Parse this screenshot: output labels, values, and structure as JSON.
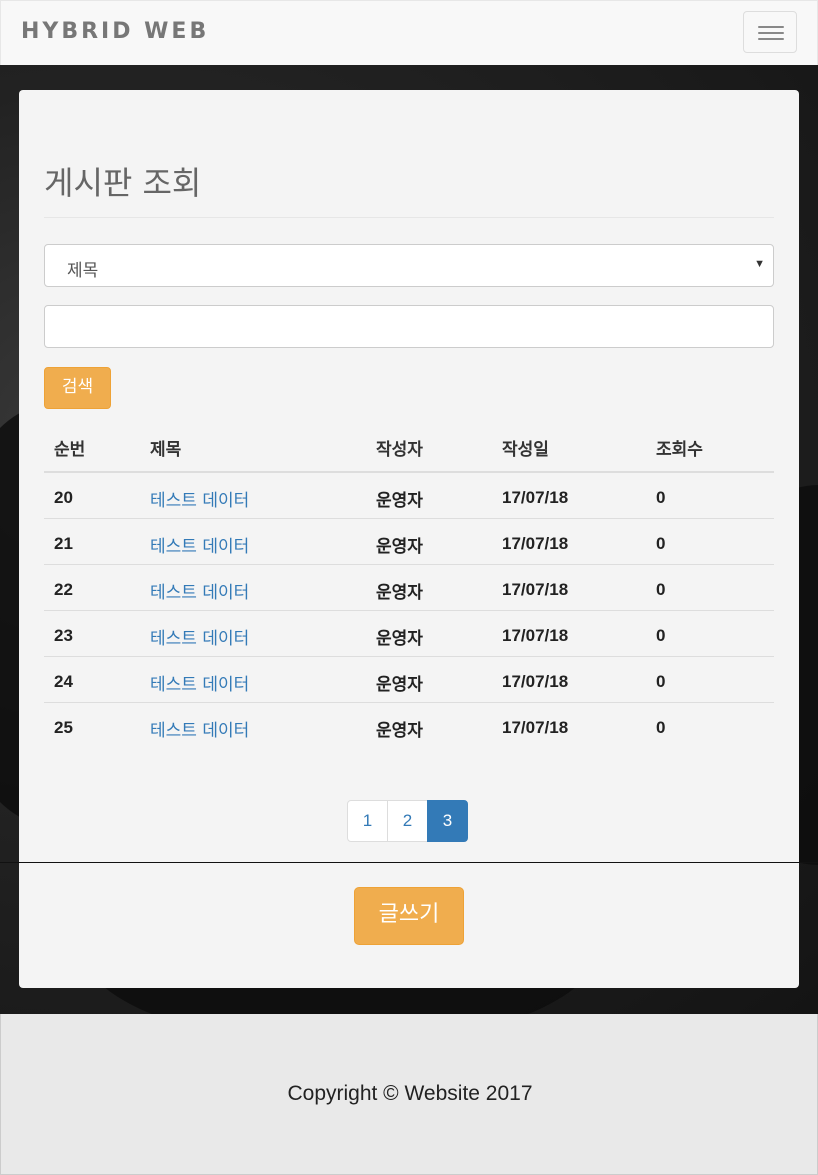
{
  "navbar": {
    "brand": "HYBRID WEB",
    "menu_icon": "hamburger-icon"
  },
  "page": {
    "title": "게시판 조회"
  },
  "search": {
    "field_selected": "제목",
    "keyword_value": "",
    "keyword_placeholder": "",
    "button_label": "검색"
  },
  "table": {
    "headers": [
      "순번",
      "제목",
      "작성자",
      "작성일",
      "조회수"
    ],
    "rows": [
      {
        "no": "20",
        "title": "테스트 데이터",
        "writer": "운영자",
        "date": "17/07/18",
        "views": "0"
      },
      {
        "no": "21",
        "title": "테스트 데이터",
        "writer": "운영자",
        "date": "17/07/18",
        "views": "0"
      },
      {
        "no": "22",
        "title": "테스트 데이터",
        "writer": "운영자",
        "date": "17/07/18",
        "views": "0"
      },
      {
        "no": "23",
        "title": "테스트 데이터",
        "writer": "운영자",
        "date": "17/07/18",
        "views": "0"
      },
      {
        "no": "24",
        "title": "테스트 데이터",
        "writer": "운영자",
        "date": "17/07/18",
        "views": "0"
      },
      {
        "no": "25",
        "title": "테스트 데이터",
        "writer": "운영자",
        "date": "17/07/18",
        "views": "0"
      }
    ]
  },
  "pagination": {
    "pages": [
      "1",
      "2",
      "3"
    ],
    "active": "3"
  },
  "write_button": "글쓰기",
  "footer": {
    "copyright": "Copyright © Website 2017"
  },
  "colors": {
    "accent": "#f0ad4e",
    "link": "#337ab7",
    "active_page": "#337ab7"
  }
}
